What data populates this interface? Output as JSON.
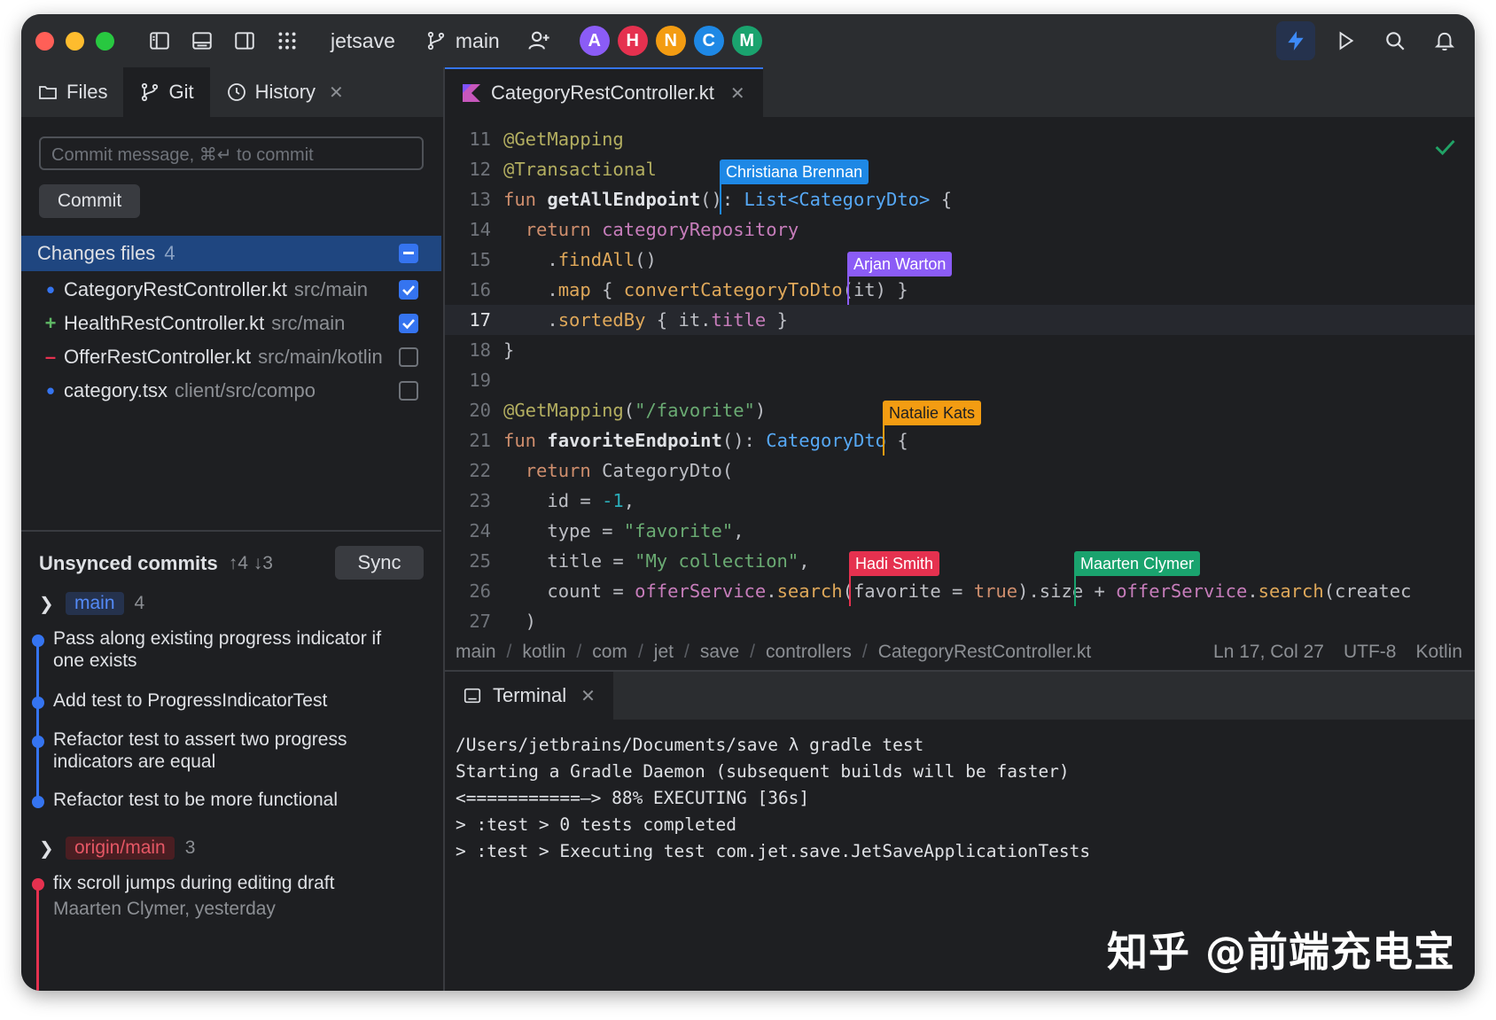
{
  "titlebar": {
    "project": "jetsave",
    "branch": "main",
    "avatars": [
      {
        "letter": "A",
        "color": "#8b5cf6"
      },
      {
        "letter": "H",
        "color": "#e5314f"
      },
      {
        "letter": "N",
        "color": "#f39c12"
      },
      {
        "letter": "C",
        "color": "#1e88e5"
      },
      {
        "letter": "M",
        "color": "#1aa36e"
      }
    ]
  },
  "left": {
    "tabs": [
      "Files",
      "Git",
      "History"
    ],
    "commit_placeholder": "Commit message, ⌘↵  to commit",
    "commit_label": "Commit",
    "changes_label": "Changes files",
    "changes_count": "4",
    "files": [
      {
        "mark": "•",
        "name": "CategoryRestController.kt",
        "path": "src/main",
        "checked": true
      },
      {
        "mark": "+",
        "name": "HealthRestController.kt",
        "path": "src/main",
        "checked": true
      },
      {
        "mark": "–",
        "name": "OfferRestController.kt",
        "path": "src/main/kotlin",
        "checked": false
      },
      {
        "mark": "•",
        "name": "category.tsx",
        "path": "client/src/components",
        "checked": false
      }
    ],
    "unsynced_title": "Unsynced commits",
    "unsynced_counts": "↑4 ↓3",
    "sync_label": "Sync",
    "local_branch": {
      "name": "main",
      "count": "4"
    },
    "local_commits": [
      "Pass along existing progress indicator if one exists",
      "Add test to ProgressIndicatorTest",
      "Refactor test to assert two progress indicators are equal",
      "Refactor test to be more functional"
    ],
    "remote_branch": {
      "name": "origin/main",
      "count": "3"
    },
    "remote_commit": {
      "title": "fix scroll jumps during editing draft",
      "author": "Maarten Clymer,  yesterday"
    }
  },
  "editor": {
    "tab": "CategoryRestController.kt",
    "line_numbers": [
      "11",
      "12",
      "13",
      "14",
      "15",
      "16",
      "17",
      "18",
      "19",
      "20",
      "21",
      "22",
      "23",
      "24",
      "25",
      "26",
      "27"
    ],
    "current_line": "17",
    "cursors": [
      {
        "name": "Christiana Brennan",
        "color": "#1e88e5"
      },
      {
        "name": "Arjan Warton",
        "color": "#8b5cf6"
      },
      {
        "name": "Natalie Kats",
        "color": "#f39c12"
      },
      {
        "name": "Hadi Smith",
        "color": "#e5314f"
      },
      {
        "name": "Maarten Clymer",
        "color": "#1aa36e"
      }
    ],
    "breadcrumb": [
      "main",
      "kotlin",
      "com",
      "jet",
      "save",
      "controllers",
      "CategoryRestController.kt"
    ],
    "status": {
      "position": "Ln 17, Col 27",
      "encoding": "UTF-8",
      "language": "Kotlin"
    }
  },
  "terminal": {
    "tab": "Terminal",
    "lines": [
      "/Users/jetbrains/Documents/save λ gradle test",
      "Starting a Gradle Daemon (subsequent builds will be faster)",
      "<===========—> 88% EXECUTING [36s]",
      "> :test > 0 tests completed",
      "> :test > Executing test com.jet.save.JetSaveApplicationTests"
    ]
  },
  "watermark": "知乎 @前端充电宝"
}
